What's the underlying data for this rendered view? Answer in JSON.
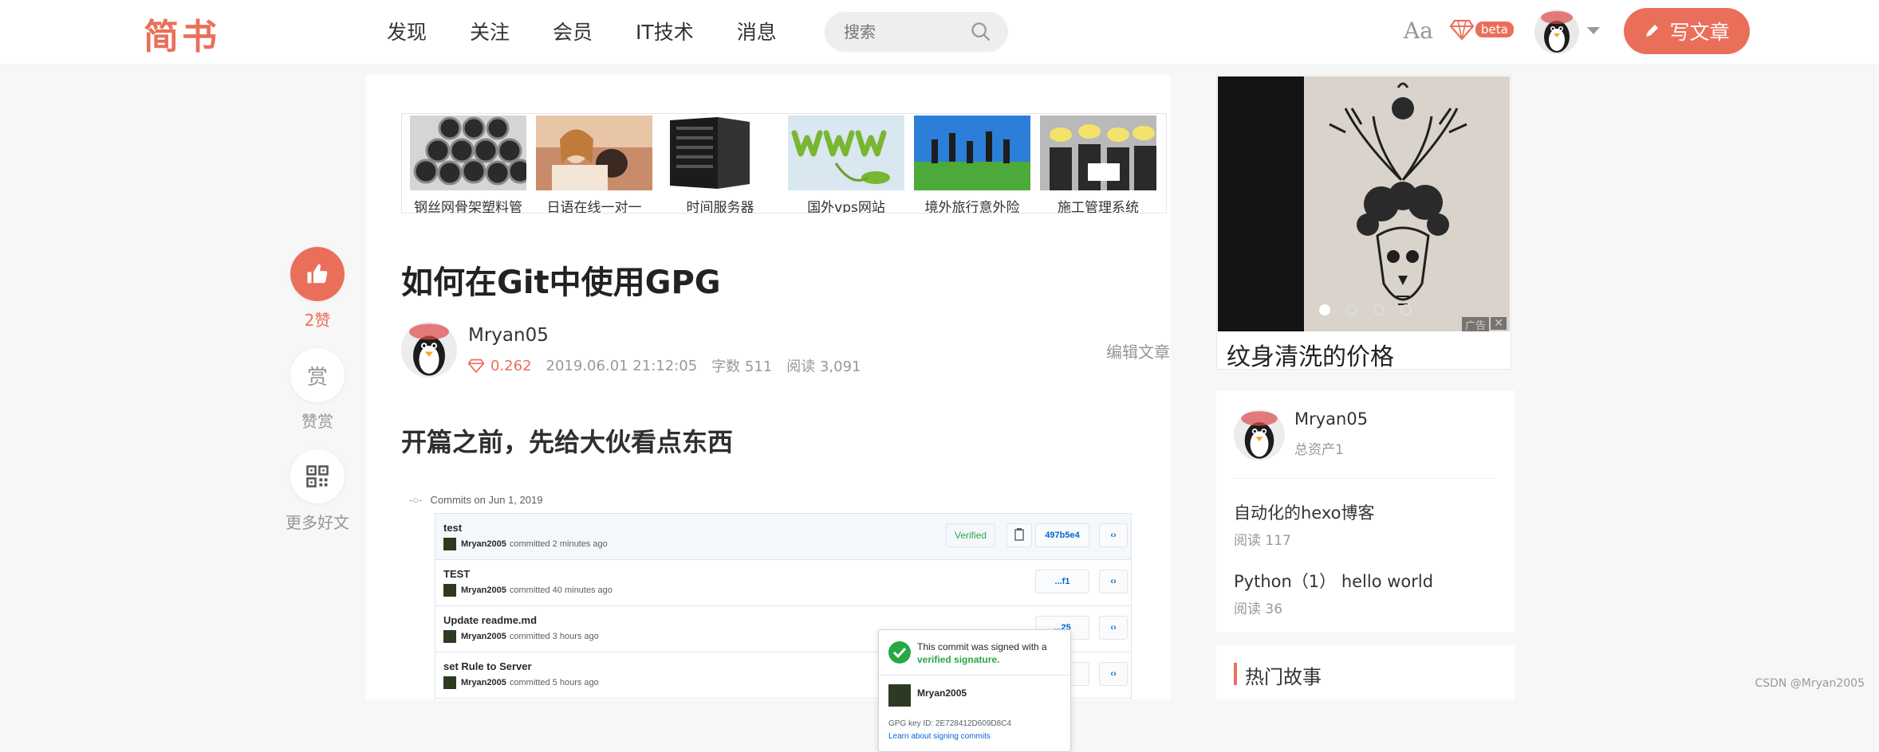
{
  "header": {
    "logo": "简书",
    "nav": [
      "发现",
      "关注",
      "会员",
      "IT技术",
      "消息"
    ],
    "search_placeholder": "搜索",
    "font_toggle": "Aa",
    "beta_badge": "beta",
    "write_button": "写文章"
  },
  "float_actions": {
    "like_count": "2赞",
    "reward_icon_text": "赏",
    "reward_label": "赞赏",
    "more_label": "更多好文"
  },
  "ad_strip": [
    {
      "caption": "钢丝网骨架塑料管",
      "icon": "steel-pipes-image"
    },
    {
      "caption": "日语在线一对一",
      "icon": "people-image"
    },
    {
      "caption": "时间服务器",
      "icon": "server-image"
    },
    {
      "caption": "国外vps网站",
      "icon": "www-image"
    },
    {
      "caption": "境外旅行意外险",
      "icon": "travel-image"
    },
    {
      "caption": "施工管理系统",
      "icon": "construction-image"
    }
  ],
  "article": {
    "title": "如何在Git中使用GPG",
    "author": "Mryan05",
    "asset": "0.262",
    "date": "2019.06.01 21:12:05",
    "word_count": "字数 511",
    "read_count": "阅读 3,091",
    "edit_link": "编辑文章",
    "section_heading": "开篇之前，先给大伙看点东西"
  },
  "github_screenshot": {
    "header": "Commits on Jun 1, 2019",
    "commits": [
      {
        "message": "test",
        "author": "Mryan2005",
        "time": "committed 2 minutes ago",
        "sha": "497b5e4"
      },
      {
        "message": "TEST",
        "author": "Mryan2005",
        "time": "committed 40 minutes ago",
        "sha": "...f1"
      },
      {
        "message": "Update readme.md",
        "author": "Mryan2005",
        "time": "committed 3 hours ago",
        "sha": "...25"
      },
      {
        "message": "set Rule to Server",
        "author": "Mryan2005",
        "time": "committed 5 hours ago",
        "sha": "...76"
      }
    ],
    "verified_label": "Verified",
    "popover": {
      "line1": "This commit was signed with a",
      "line2": "verified signature.",
      "user": "Mryan2005",
      "gpg_key": "GPG key ID: 2E728412D609D8C4",
      "link": "Learn about signing commits"
    }
  },
  "right_ad": {
    "caption": "纹身清洗的价格",
    "badge": "广告"
  },
  "author_card": {
    "name": "Mryan05",
    "asset": "总资产1",
    "articles": [
      {
        "title": "自动化的hexo博客",
        "reads": "阅读 117"
      },
      {
        "title": "Python（1） hello world",
        "reads": "阅读 36"
      }
    ]
  },
  "hot_section": {
    "title": "热门故事"
  },
  "watermark": "CSDN @Mryan2005",
  "colors": {
    "brand": "#ea6f5a",
    "verified": "#28a745",
    "link": "#0366d6"
  }
}
